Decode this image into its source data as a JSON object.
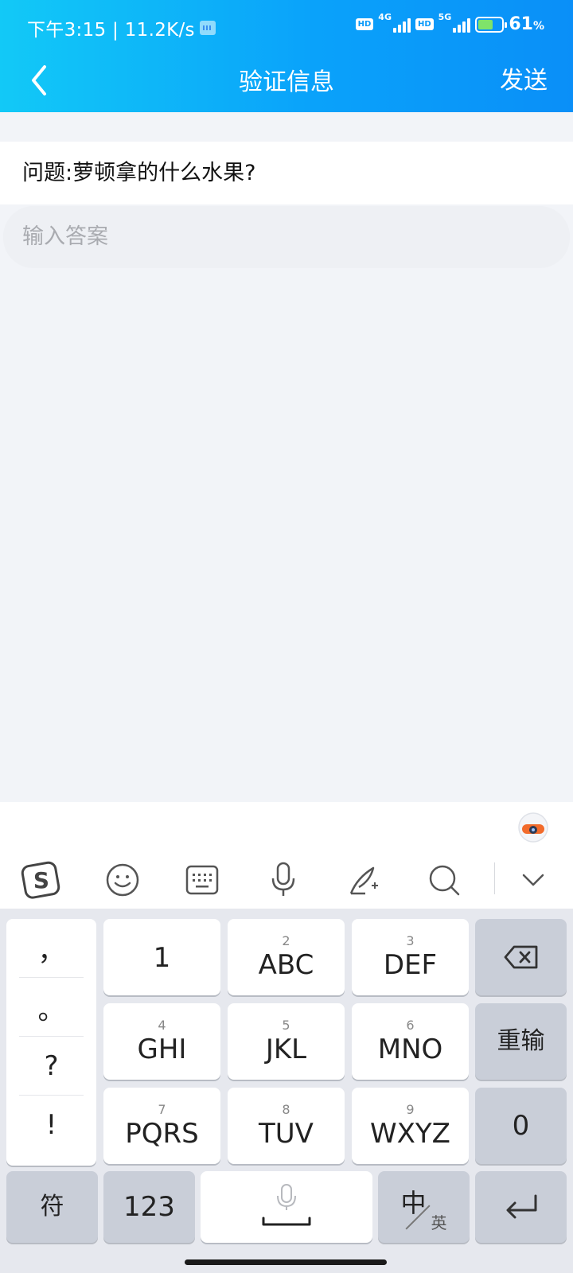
{
  "status_bar": {
    "time_speed": "下午3:15 | 11.2K/s",
    "sim1_network": "4G",
    "sim2_network": "5G",
    "hd1": "HD",
    "hd2": "HD",
    "battery": "61",
    "battery_unit": "%"
  },
  "header": {
    "title": "验证信息",
    "send_label": "发送"
  },
  "question": {
    "text": "问题:萝顿拿的什么水果?"
  },
  "answer_input": {
    "value": "",
    "placeholder": "输入答案"
  },
  "keyboard": {
    "toolbar_icons": [
      "sogou-logo-icon",
      "emoji-icon",
      "keyboard-layout-icon",
      "microphone-icon",
      "handwriting-icon",
      "search-icon",
      "collapse-keyboard-icon"
    ],
    "punctuation": [
      "，",
      "。",
      "?",
      "!"
    ],
    "keys": [
      {
        "sub": "",
        "main": "1"
      },
      {
        "sub": "2",
        "main": "ABC"
      },
      {
        "sub": "3",
        "main": "DEF"
      },
      {
        "sub": "4",
        "main": "GHI"
      },
      {
        "sub": "5",
        "main": "JKL"
      },
      {
        "sub": "6",
        "main": "MNO"
      },
      {
        "sub": "7",
        "main": "PQRS"
      },
      {
        "sub": "8",
        "main": "TUV"
      },
      {
        "sub": "9",
        "main": "WXYZ"
      }
    ],
    "retype_label": "重输",
    "zero_label": "0",
    "symbol_label": "符",
    "number_label": "123",
    "lang_main": "中",
    "lang_sub": "英",
    "accent_color": "#0a9af9"
  }
}
